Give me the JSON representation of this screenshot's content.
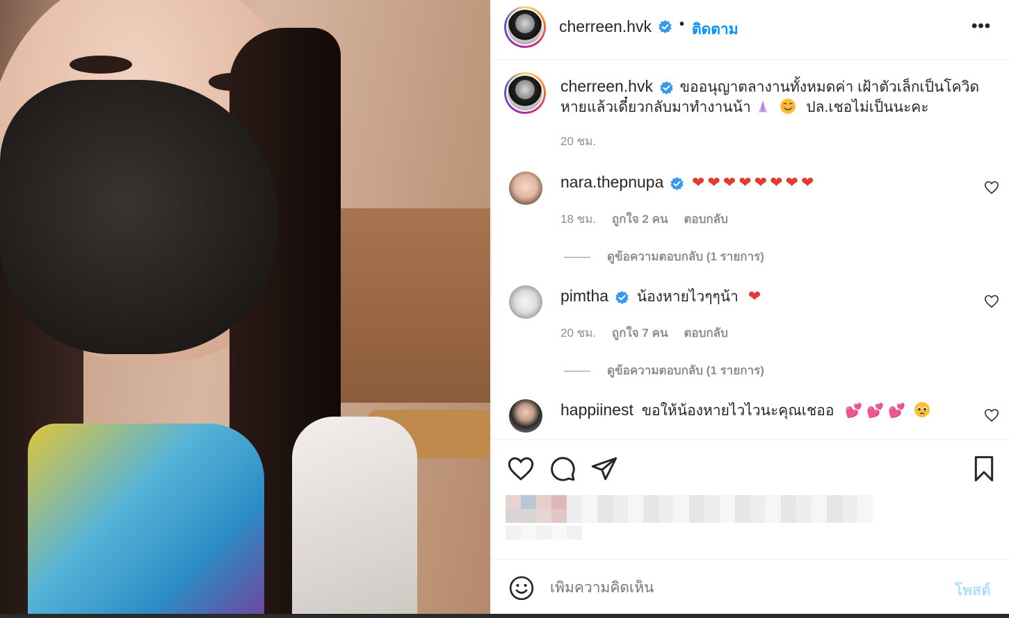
{
  "post": {
    "header": {
      "username": "cherreen.hvk",
      "separator": "•",
      "follow_label": "ติดตาม",
      "more_label": "•••",
      "verified_icon": "verified-badge-icon"
    },
    "caption": {
      "username": "cherreen.hvk",
      "line1": "ขออนุญาตลางานทั้งหมดค่า เฝ้าตัวเล็กเป็นโควิด",
      "line2a": "หายแล้วเดี๋ยวกลับมาทำงานน้า",
      "line2b": "ปล.เชอไม่เป็นนะคะ",
      "time": "20 ชม."
    },
    "comments": [
      {
        "username": "nara.thepnupa",
        "verified": true,
        "text": "",
        "emoji": "red-hearts x8",
        "time": "18 ชม.",
        "likes": "ถูกใจ 2 คน",
        "reply_label": "ตอบกลับ",
        "view_replies": "ดูข้อความตอบกลับ (1 รายการ)"
      },
      {
        "username": "pimtha",
        "verified": true,
        "text": "น้องหายไวๆๆน้า",
        "emoji": "red-heart",
        "time": "20 ชม.",
        "likes": "ถูกใจ 7 คน",
        "reply_label": "ตอบกลับ",
        "view_replies": "ดูข้อความตอบกลับ (1 รายการ)"
      },
      {
        "username": "happiinest",
        "verified": false,
        "text": "ขอให้น้องหายไวไวนะคุณเชออ",
        "emoji": "two-hearts x3, pleading-face"
      }
    ],
    "actions": {
      "like_icon": "heart-icon",
      "comment_icon": "comment-icon",
      "share_icon": "share-icon",
      "save_icon": "bookmark-icon"
    },
    "add_comment": {
      "emoji_icon": "smiley-icon",
      "placeholder": "เพิ่มความคิดเห็น",
      "post_label": "โพสต์"
    },
    "colors": {
      "accent": "#0095f6",
      "muted": "#8e8e8e",
      "heart_red": "#ed4956",
      "post_disabled": "#b2dffc",
      "verified_blue": "#3897f0"
    }
  }
}
